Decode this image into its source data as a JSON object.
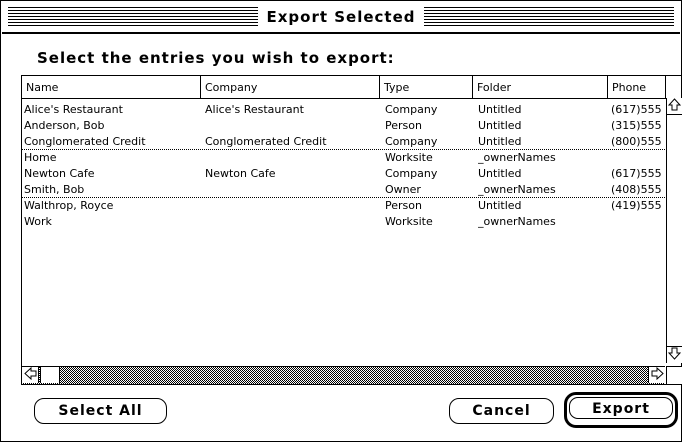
{
  "dialog": {
    "title": "Export Selected",
    "prompt": "Select the entries you wish to export:"
  },
  "table": {
    "columns": [
      "Name",
      "Company",
      "Type",
      "Folder",
      "Phone"
    ],
    "rows": [
      {
        "name": "Alice's Restaurant",
        "company": "Alice's Restaurant",
        "type": "Company",
        "folder": "Untitled",
        "phone": "(617)555"
      },
      {
        "name": "Anderson, Bob",
        "company": "",
        "type": "Person",
        "folder": "Untitled",
        "phone": "(315)555"
      },
      {
        "name": "Conglomerated Credit",
        "company": "Conglomerated Credit",
        "type": "Company",
        "folder": "Untitled",
        "phone": "(800)555"
      },
      {
        "name": "Home",
        "company": "",
        "type": "Worksite",
        "folder": "_ownerNames",
        "phone": ""
      },
      {
        "name": "Newton Cafe",
        "company": "Newton Cafe",
        "type": "Company",
        "folder": "Untitled",
        "phone": "(617)555"
      },
      {
        "name": "Smith, Bob",
        "company": "",
        "type": "Owner",
        "folder": "_ownerNames",
        "phone": "(408)555"
      },
      {
        "name": "Walthrop, Royce",
        "company": "",
        "type": "Person",
        "folder": "Untitled",
        "phone": "(419)555"
      },
      {
        "name": "Work",
        "company": "",
        "type": "Worksite",
        "folder": "_ownerNames",
        "phone": ""
      }
    ]
  },
  "scrollbars": {
    "up_icon": "arrow-up-icon",
    "down_icon": "arrow-down-icon",
    "left_icon": "arrow-left-icon",
    "right_icon": "arrow-right-icon"
  },
  "buttons": {
    "select_all": "Select All",
    "cancel": "Cancel",
    "export": "Export"
  }
}
